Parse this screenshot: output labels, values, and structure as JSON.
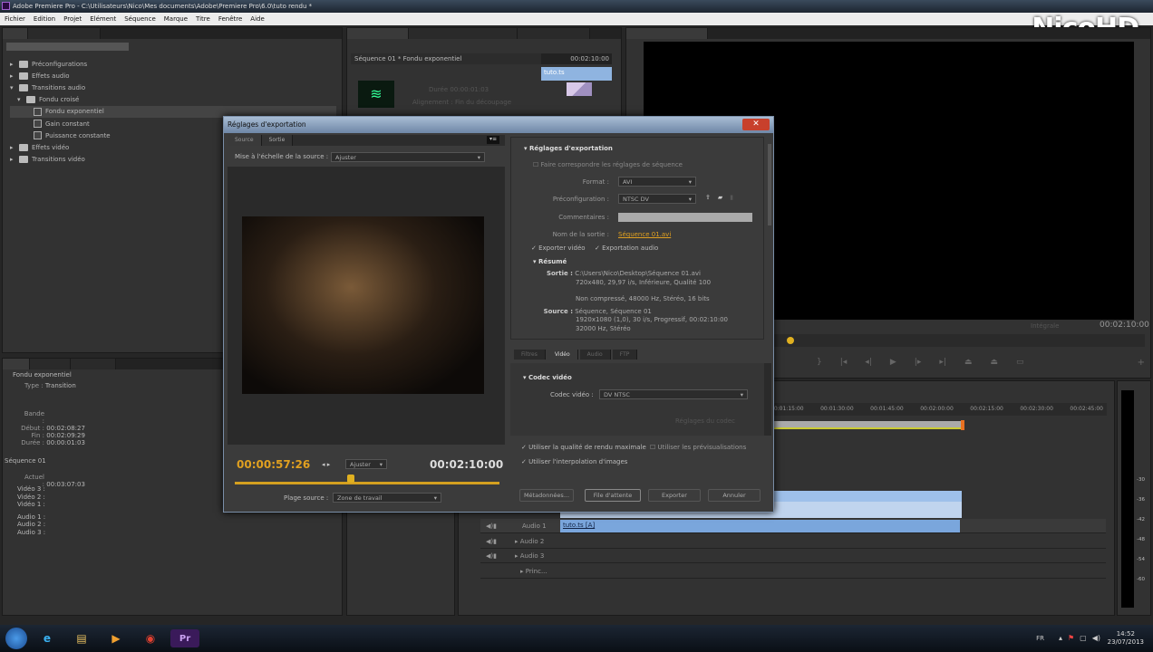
{
  "window": {
    "title": "Adobe Premiere Pro - C:\\Utilisateurs\\Nico\\Mes documents\\Adobe\\Premiere Pro\\6.0\\tuto rendu *"
  },
  "menu": [
    "Fichier",
    "Edition",
    "Projet",
    "Elément",
    "Séquence",
    "Marque",
    "Titre",
    "Fenêtre",
    "Aide"
  ],
  "logo": "NicoHD",
  "effects": {
    "items": [
      {
        "label": "Préconfigurations",
        "type": "folder",
        "level": 0,
        "open": false
      },
      {
        "label": "Effets audio",
        "type": "folder",
        "level": 0,
        "open": false
      },
      {
        "label": "Transitions audio",
        "type": "folder",
        "level": 0,
        "open": true
      },
      {
        "label": "Fondu croisé",
        "type": "folder",
        "level": 1,
        "open": true
      },
      {
        "label": "Fondu exponentiel",
        "type": "fx",
        "level": 2,
        "selected": true
      },
      {
        "label": "Gain constant",
        "type": "fx",
        "level": 2
      },
      {
        "label": "Puissance constante",
        "type": "fx",
        "level": 2
      },
      {
        "label": "Effets vidéo",
        "type": "folder",
        "level": 0,
        "open": false
      },
      {
        "label": "Transitions vidéo",
        "type": "folder",
        "level": 0,
        "open": false
      }
    ]
  },
  "info": {
    "clip": "Fondu exponentiel",
    "type_label": "Type :",
    "type": "Transition",
    "bande": "Bande :",
    "debut_label": "Début :",
    "debut": "00:02:08:27",
    "fin_label": "Fin :",
    "fin": "00:02:09:29",
    "duree_label": "Durée :",
    "duree": "00:00:01:03",
    "sequence": "Séquence 01",
    "actuel_label": "Actuel :",
    "actuel": "00:03:07:03",
    "tracks": [
      "Vidéo 3 :",
      "Vidéo 2 :",
      "Vidéo 1 :",
      "Audio 1 :",
      "Audio 2 :",
      "Audio 3 :"
    ]
  },
  "source": {
    "header": "Séquence 01 * Fondu exponentiel",
    "timecode": "00:02:10:00",
    "clip": "tuto.ts",
    "duree_label": "Durée",
    "duree": "00:00:01:03",
    "align_label": "Alignement :",
    "align": "Fin du découpage"
  },
  "program": {
    "zoom": "Intégrale",
    "timecode": "00:02:10:00"
  },
  "timeline": {
    "ruler": [
      "00:01:15:00",
      "00:01:30:00",
      "00:01:45:00",
      "00:02:00:00",
      "00:02:15:00",
      "00:02:30:00",
      "00:02:45:00"
    ],
    "tracks": [
      {
        "name": "Audio 1",
        "clip": "tuto.ts [A]"
      },
      {
        "name": "Audio 2"
      },
      {
        "name": "Audio 3"
      },
      {
        "name": "Princ..."
      }
    ]
  },
  "meter": [
    "-30",
    "-36",
    "-42",
    "-48",
    "-54",
    "-60"
  ],
  "dialog": {
    "title": "Réglages d'exportation",
    "tabs": [
      "Source",
      "Sortie"
    ],
    "scale_label": "Mise à l'échelle de la source :",
    "scale": "Ajuster",
    "current_time": "00:00:57:26",
    "fit": "Ajuster",
    "duration": "00:02:10:00",
    "range_label": "Plage source :",
    "range": "Zone de travail",
    "playhead_fraction": 0.44,
    "section": "Réglages d'exportation",
    "match": "Faire correspondre les réglages de séquence",
    "format_label": "Format :",
    "format": "AVI",
    "preset_label": "Préconfiguration :",
    "preset": "NTSC DV",
    "comments_label": "Commentaires :",
    "output_label": "Nom de la sortie :",
    "output": "Séquence 01.avi",
    "export_video": "Exporter vidéo",
    "export_audio": "Exportation audio",
    "summary": "Résumé",
    "out_label": "Sortie :",
    "out1": "C:\\Users\\Nico\\Desktop\\Séquence 01.avi",
    "out2": "720x480, 29,97 i/s, Inférieure, Qualité  100",
    "out3": "Non compressé, 48000 Hz, Stéréo, 16 bits",
    "src_label": "Source :",
    "src1": "Séquence, Séquence 01",
    "src2": "1920x1080 (1,0), 30  i/s, Progressif, 00:02:10:00",
    "src3": "32000 Hz, Stéréo",
    "sub_tabs": [
      "Filtres",
      "Vidéo",
      "Audio",
      "FTP"
    ],
    "codec_section": "Codec vidéo",
    "codec_label": "Codec vidéo :",
    "codec": "DV NTSC",
    "codec_btn": "Réglages du codec",
    "max_quality": "Utiliser la qualité de rendu maximale",
    "previews": "Utiliser les prévisualisations",
    "interp": "Utiliser l'interpolation d'images",
    "buttons": {
      "meta": "Métadonnées...",
      "queue": "File d'attente",
      "export": "Exporter",
      "cancel": "Annuler"
    }
  },
  "taskbar": {
    "lang": "FR",
    "time": "14:52",
    "date": "23/07/2013",
    "apps": [
      "Internet Explorer",
      "Explorateur",
      "Media Player",
      "Chrome",
      "Pr"
    ]
  }
}
